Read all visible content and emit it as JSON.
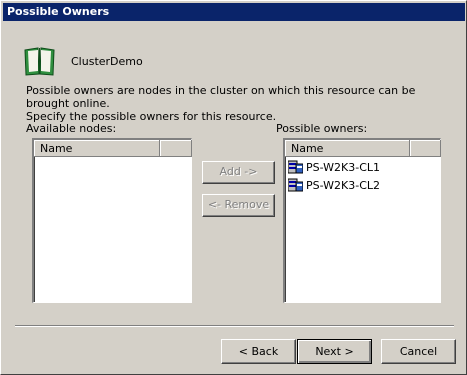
{
  "window": {
    "title": "Possible Owners"
  },
  "resource": {
    "name": "ClusterDemo",
    "icon": "book-icon"
  },
  "description": {
    "line1": "Possible owners are nodes in the cluster on which this resource can be brought online.",
    "line2": "Specify the possible owners for this resource."
  },
  "available_nodes": {
    "label": "Available nodes:",
    "columns": [
      "Name",
      ""
    ],
    "items": []
  },
  "possible_owners": {
    "label": "Possible owners:",
    "columns": [
      "Name",
      ""
    ],
    "items": [
      "PS-W2K3-CL1",
      "PS-W2K3-CL2"
    ]
  },
  "buttons": {
    "add": "Add ->",
    "remove": "<- Remove",
    "back": "< Back",
    "next": "Next >",
    "cancel": "Cancel"
  },
  "colors": {
    "titlebar": "#0a246a",
    "face": "#d4d0c8",
    "disabled_text": "#808080"
  }
}
